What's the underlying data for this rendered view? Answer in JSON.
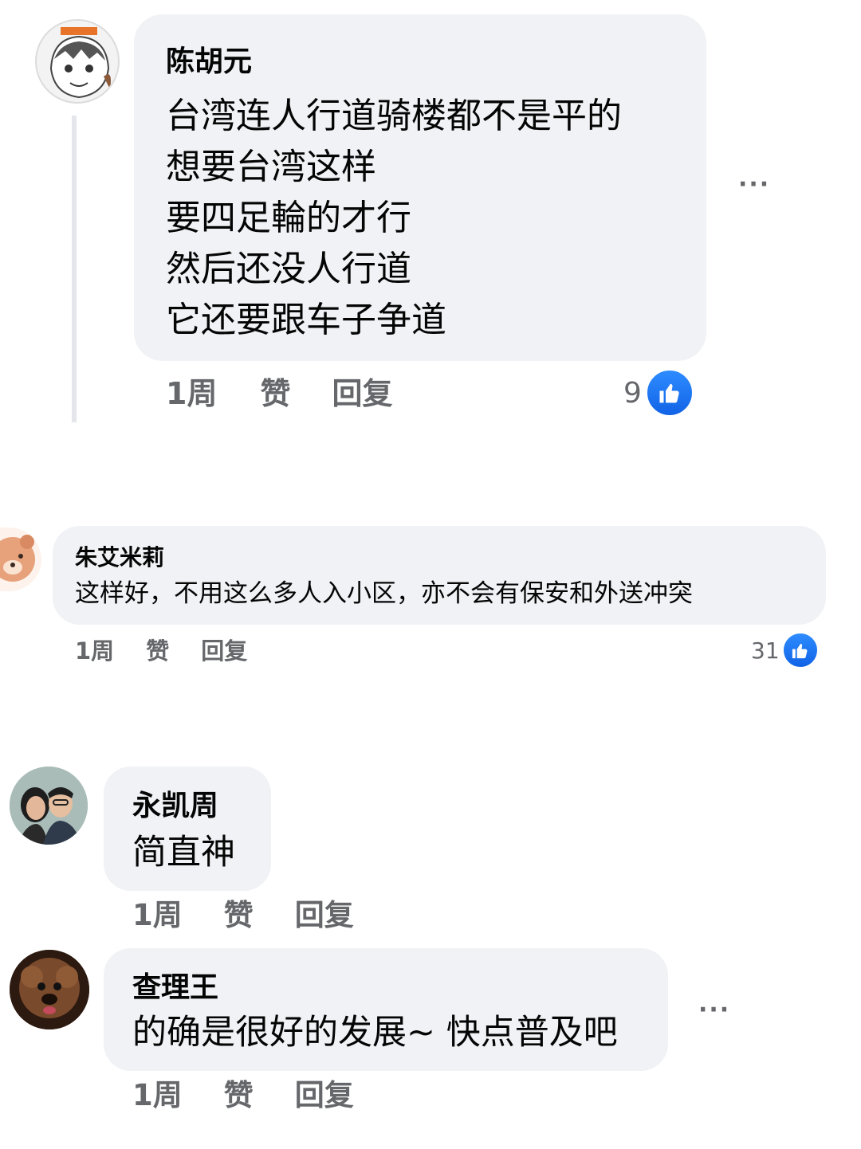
{
  "comments": [
    {
      "author": "陈胡元",
      "lines": [
        "台湾连人行道骑楼都不是平的",
        "想要台湾这样",
        "要四足輪的才行",
        "然后还没人行道",
        "它还要跟车子争道"
      ],
      "time": "1周",
      "like_label": "赞",
      "reply_label": "回复",
      "reaction_count": "9",
      "more": "···",
      "avatar_icon": "manga-avatar-icon"
    },
    {
      "author": "朱艾米莉",
      "lines": [
        "这样好，不用这么多人入小区，亦不会有保安和外送冲突"
      ],
      "time": "1周",
      "like_label": "赞",
      "reply_label": "回复",
      "reaction_count": "31",
      "avatar_icon": "bear-avatar-icon"
    },
    {
      "author": "永凯周",
      "lines": [
        "简直神"
      ],
      "time": "1周",
      "like_label": "赞",
      "reply_label": "回复",
      "avatar_icon": "couple-photo-avatar-icon"
    },
    {
      "author": "查理王",
      "lines": [
        "的确是很好的发展~ 快点普及吧"
      ],
      "time": "1周",
      "like_label": "赞",
      "reply_label": "回复",
      "more": "···",
      "avatar_icon": "dog-photo-avatar-icon"
    }
  ],
  "colors": {
    "bubble": "#f0f2f5",
    "meta_text": "#65676b",
    "like_blue": "#1877f2",
    "thread_line": "#e4e6eb"
  }
}
